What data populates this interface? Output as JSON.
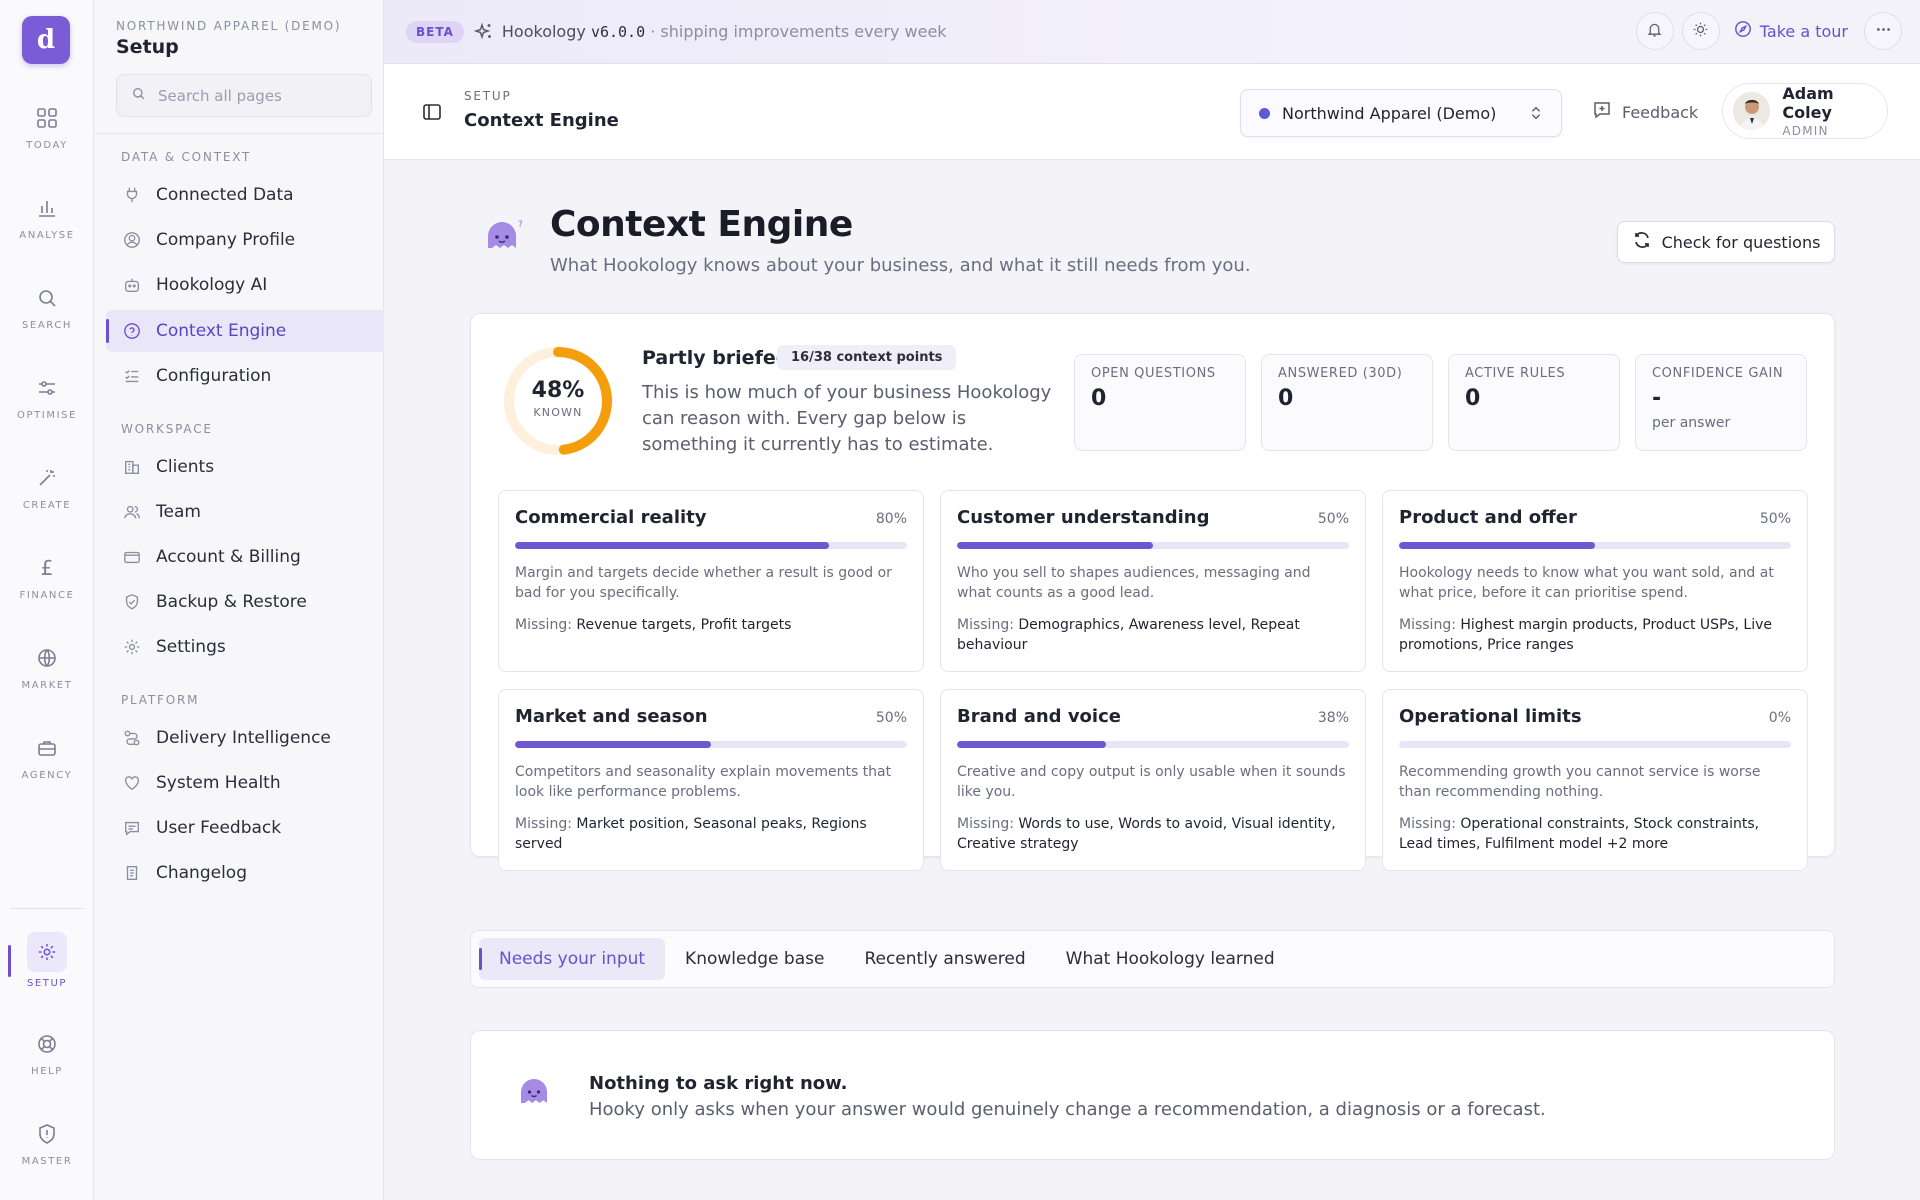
{
  "rail": {
    "logo": "d",
    "items": [
      {
        "label": "TODAY",
        "icon": "grid-icon"
      },
      {
        "label": "ANALYSE",
        "icon": "bar-chart-icon"
      },
      {
        "label": "SEARCH",
        "icon": "search-icon"
      },
      {
        "label": "OPTIMISE",
        "icon": "sliders-icon"
      },
      {
        "label": "CREATE",
        "icon": "magic-wand-icon"
      },
      {
        "label": "FINANCE",
        "icon": "pound-icon"
      },
      {
        "label": "MARKET",
        "icon": "globe-icon"
      },
      {
        "label": "AGENCY",
        "icon": "briefcase-icon"
      },
      {
        "label": "SETUP",
        "icon": "gear-icon"
      },
      {
        "label": "HELP",
        "icon": "lifebuoy-icon"
      },
      {
        "label": "MASTER",
        "icon": "shield-icon"
      }
    ]
  },
  "sidenav": {
    "org": "NORTHWIND APPAREL (DEMO)",
    "title": "Setup",
    "search_placeholder": "Search all pages",
    "sections": [
      {
        "label": "DATA & CONTEXT",
        "items": [
          "Connected Data",
          "Company Profile",
          "Hookology AI",
          "Context Engine",
          "Configuration"
        ]
      },
      {
        "label": "WORKSPACE",
        "items": [
          "Clients",
          "Team",
          "Account & Billing",
          "Backup & Restore",
          "Settings"
        ]
      },
      {
        "label": "PLATFORM",
        "items": [
          "Delivery Intelligence",
          "System Health",
          "User Feedback",
          "Changelog"
        ]
      }
    ],
    "active": "Context Engine"
  },
  "banner": {
    "beta": "BETA",
    "product": "Hookology",
    "version": "v6.0.0",
    "tagline": "· shipping improvements every week",
    "tour": "Take a tour"
  },
  "header": {
    "crumb": "SETUP",
    "title": "Context Engine",
    "org_select": "Northwind Apparel (Demo)",
    "feedback": "Feedback",
    "user_name": "Adam Coley",
    "user_role": "ADMIN"
  },
  "hero": {
    "title": "Context Engine",
    "subtitle": "What Hookology knows about your business, and what it still needs from you.",
    "check_button": "Check for questions"
  },
  "summary": {
    "percent": "48%",
    "percent_value": 0.48,
    "percent_label": "KNOWN",
    "status": "Partly briefed",
    "badge": "16/38 context points",
    "description": "This is how much of your business Hookology can reason with. Every gap below is something it currently has to estimate.",
    "stats": [
      {
        "label": "OPEN QUESTIONS",
        "value": "0",
        "sub": ""
      },
      {
        "label": "ANSWERED (30D)",
        "value": "0",
        "sub": ""
      },
      {
        "label": "ACTIVE RULES",
        "value": "0",
        "sub": ""
      },
      {
        "label": "CONFIDENCE GAIN",
        "value": "-",
        "sub": "per answer"
      }
    ]
  },
  "missing_label": "Missing:",
  "areas": [
    {
      "title": "Commercial reality",
      "pct": "80%",
      "value": 0.8,
      "desc": "Margin and targets decide whether a result is good or bad for you specifically.",
      "missing": "Revenue targets, Profit targets"
    },
    {
      "title": "Customer understanding",
      "pct": "50%",
      "value": 0.5,
      "desc": "Who you sell to shapes audiences, messaging and what counts as a good lead.",
      "missing": "Demographics, Awareness level, Repeat behaviour"
    },
    {
      "title": "Product and offer",
      "pct": "50%",
      "value": 0.5,
      "desc": "Hookology needs to know what you want sold, and at what price, before it can prioritise spend.",
      "missing": "Highest margin products, Product USPs, Live promotions, Price ranges"
    },
    {
      "title": "Market and season",
      "pct": "50%",
      "value": 0.5,
      "desc": "Competitors and seasonality explain movements that look like performance problems.",
      "missing": "Market position, Seasonal peaks, Regions served"
    },
    {
      "title": "Brand and voice",
      "pct": "38%",
      "value": 0.38,
      "desc": "Creative and copy output is only usable when it sounds like you.",
      "missing": "Words to use, Words to avoid, Visual identity, Creative strategy"
    },
    {
      "title": "Operational limits",
      "pct": "0%",
      "value": 0,
      "desc": "Recommending growth you cannot service is worse than recommending nothing.",
      "missing": "Operational constraints, Stock constraints, Lead times, Fulfilment model +2 more"
    }
  ],
  "tabs": [
    "Needs your input",
    "Knowledge base",
    "Recently answered",
    "What Hookology learned"
  ],
  "active_tab": "Needs your input",
  "empty": {
    "title": "Nothing to ask right now.",
    "subtitle": "Hooky only asks when your answer would genuinely change a recommendation, a diagnosis or a forecast."
  },
  "colors": {
    "accent": "#6a4fcf",
    "donut": "#f59e0b",
    "donut_track": "#fdf0dc",
    "progress": "#6f58cf"
  }
}
